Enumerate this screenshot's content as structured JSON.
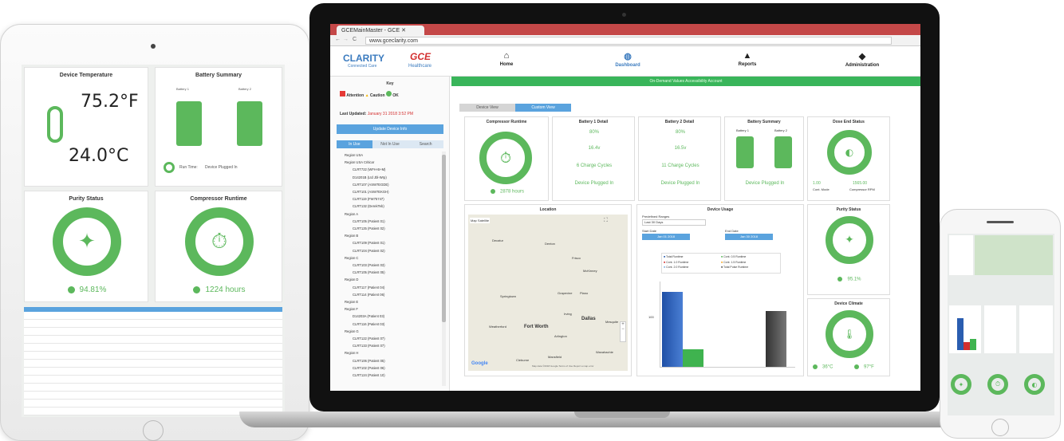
{
  "tablet": {
    "device_temperature": {
      "title": "Device Temperature",
      "fahrenheit": "75.2°F",
      "celsius": "24.0°C"
    },
    "battery_summary": {
      "title": "Battery Summary",
      "battery1": "Battery 1",
      "battery2": "Battery 2",
      "run_time": "Run Time:",
      "status": "Device Plugged In"
    },
    "purity_status": {
      "title": "Purity Status",
      "value": "94.81%"
    },
    "compressor_runtime": {
      "title": "Compressor Runtime",
      "value": "1224 hours"
    }
  },
  "browser": {
    "tab_title": "GCEMainMaster - GCE",
    "url": "www.gceclarity.com"
  },
  "header": {
    "brand": "CLARITY",
    "brand_sub": "Connected Care",
    "partner": "GCE",
    "partner_sub": "Healthcare",
    "nav": [
      "Home",
      "Dashboard",
      "Reports",
      "Administration"
    ],
    "banner": "On-Demand Values Accessibility Account"
  },
  "sidebar": {
    "key_title": "Key",
    "key_items": [
      "Attention",
      "Caution",
      "OK"
    ],
    "last_updated_label": "Last Updated:",
    "last_updated_value": "January 31 2018 3:52 PM",
    "update_button": "Update Device Info",
    "tabs": [
      "In Use",
      "Not In Use",
      "Search"
    ],
    "tree": [
      "Region USA",
      "Region USA Criticar",
      "CLRT722 (WFH-B+M)",
      "D14201B (Ltd Jbl-Wrp)",
      "CLRT107 (ASW7EGDE)",
      "CLRT101 (ASW7EKGH)",
      "CLRT119 (FW75747)",
      "CLRT132 (DerekTeb)",
      "Region A",
      "CLRT105 (Patient 01)",
      "CLRT125 (Patient 02)",
      "Region B",
      "CLRT109 (Patient 01)",
      "CLRT104 (Patient 02)",
      "Region C",
      "CLRT103 (Patient 03)",
      "CLRT105 (Patient 05)",
      "Region D",
      "CLRT117 (Patient 04)",
      "CLRT114 (Patient 06)",
      "Region E",
      "Region F",
      "D14203A (Patient 03)",
      "CLRT116 (Patient 03)",
      "Region G",
      "CLRT122 (Patient 07)",
      "CLRT133 (Patient 07)",
      "Region H",
      "CLRT106 (Patient 05)",
      "CLRT102 (Patient 06)",
      "CLRT124 (Patient 10)"
    ]
  },
  "view_tabs": [
    "Device View",
    "Custom View"
  ],
  "cards": {
    "compressor": {
      "title": "Compressor Runtime",
      "value": "2878 hours"
    },
    "battery1": {
      "title": "Battery 1 Detail",
      "charge": "80%",
      "voltage": "16.4v",
      "cycles": "6 Charge Cycles",
      "status": "Device Plugged In"
    },
    "battery2": {
      "title": "Battery 2 Detail",
      "charge": "80%",
      "voltage": "16.5v",
      "cycles": "11 Charge Cycles",
      "status": "Device Plugged In"
    },
    "battery_summary": {
      "title": "Battery Summary",
      "b1": "Battery 1",
      "b2": "Battery 2",
      "status": "Device Plugged In"
    },
    "dose": {
      "title": "Dose End Status",
      "cont_val": "1.00",
      "cont_label": "Cont. Mode",
      "comp_val": "1565.00",
      "comp_label": "Compressor RPM"
    },
    "location": {
      "title": "Location",
      "map": "Map",
      "satellite": "Satellite",
      "google": "Google",
      "footer": "Map data ©2018 Google   Terms of Use   Report a map error",
      "cities": [
        "Denton",
        "McKinney",
        "Frisco",
        "Plano",
        "Grapevine",
        "Irving",
        "Dallas",
        "Fort Worth",
        "Arlington",
        "Mesquite",
        "Mansfield",
        "Cleburne",
        "Weatherford",
        "Decatur",
        "Springtown",
        "Waxahachie"
      ]
    },
    "usage": {
      "title": "Device Usage",
      "predef_label": "Predefined Ranges",
      "predef_value": "Last 30 Days",
      "start_label": "Start Date",
      "start_value": "Jan 01 2018",
      "end_label": "End Date",
      "end_value": "Jan 30 2018",
      "legend": [
        "Total Runtime",
        "Cont. 0.5 Runtime",
        "Cont. 1.0 Runtime",
        "Cont. 1.5 Runtime",
        "Cont. 2.0 Runtime",
        "Total Pulse Runtime"
      ],
      "ytick": "100"
    },
    "purity": {
      "title": "Purity Status",
      "value": "95.1%"
    },
    "climate": {
      "title": "Device Climate",
      "celsius": "36°C",
      "fahrenheit": "97°F"
    }
  },
  "colors": {
    "green": "#5cb85c",
    "blue": "#5aa3de",
    "red_tab": "#c44848",
    "banner": "#39b55a"
  }
}
